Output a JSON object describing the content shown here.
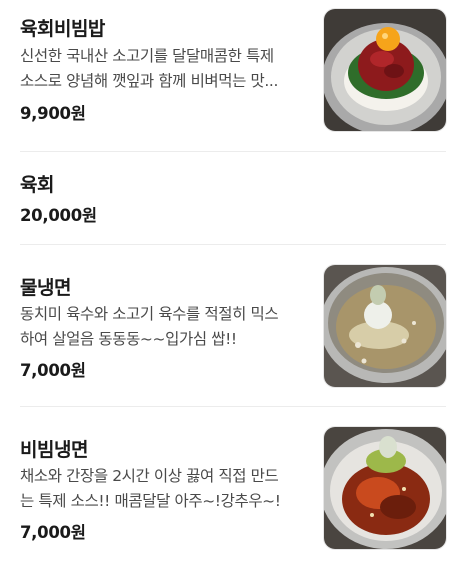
{
  "menu": {
    "items": [
      {
        "name": "육회비빔밥",
        "desc_lines": [
          "신선한 국내산 소고기를 달달매콤한 특제",
          "소스로 양념해 깻잎과 함께 비벼먹는 맛..."
        ],
        "price": "9,900원",
        "image": "yukhoe-bibimbap-photo"
      },
      {
        "name": "육회",
        "desc_lines": [],
        "price": "20,000원",
        "image": null
      },
      {
        "name": "물냉면",
        "desc_lines": [
          "동치미 육수와 소고기 육수를 적절히 믹스",
          "하여 살얼음 동동동~~입가심 쌉!!"
        ],
        "price": "7,000원",
        "image": "mul-naengmyeon-photo"
      },
      {
        "name": "비빔냉면",
        "desc_lines": [
          "채소와 간장을 2시간 이상 끓여 직접 만드",
          "는 특제 소스!! 매콤달달 아주~!강추우~!"
        ],
        "price": "7,000원",
        "image": "bibim-naengmyeon-photo"
      }
    ]
  }
}
